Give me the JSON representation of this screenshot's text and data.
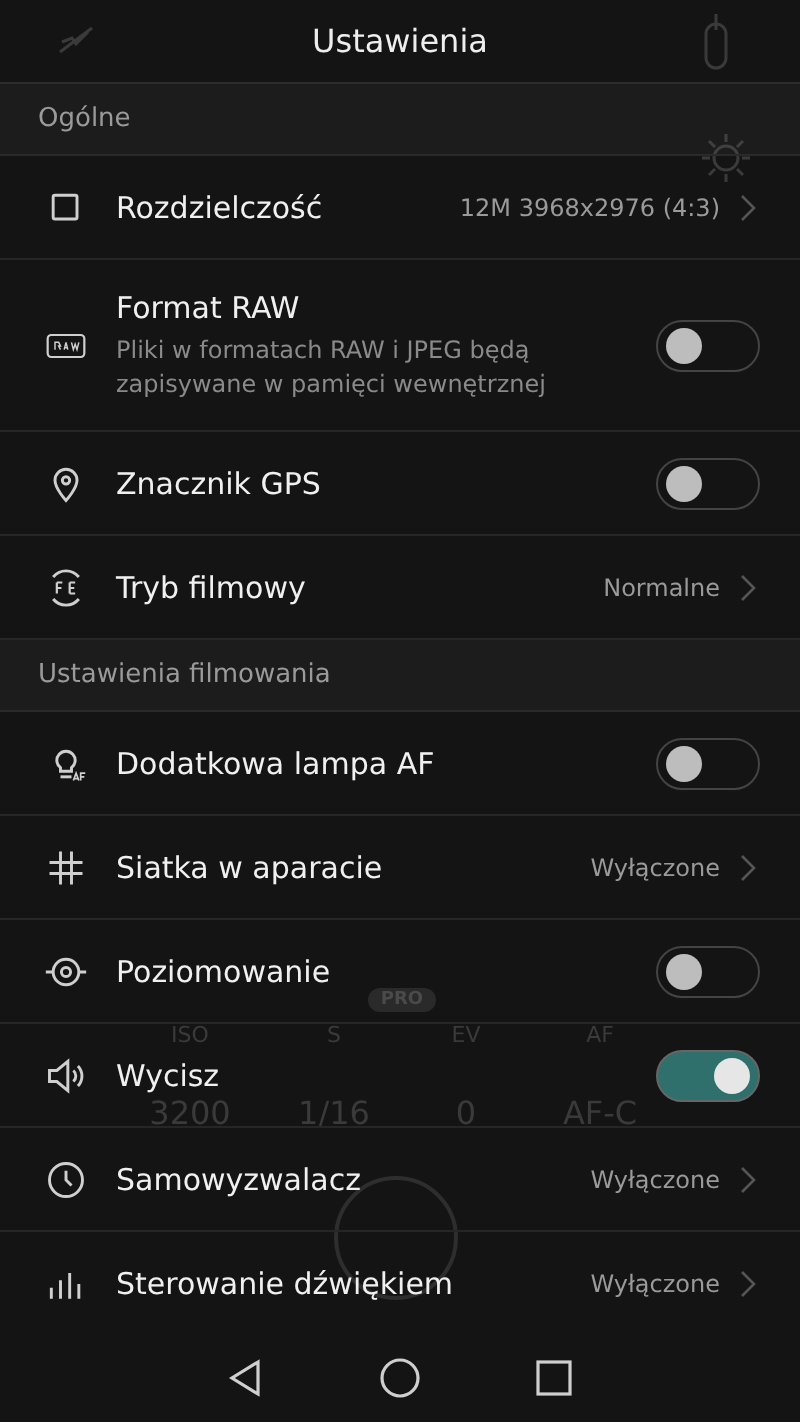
{
  "header": {
    "title": "Ustawienia"
  },
  "camera_background": {
    "mode_badge": "PRO",
    "parameters": [
      {
        "label": "ISO",
        "value": "3200"
      },
      {
        "label": "S",
        "value": "1/16"
      },
      {
        "label": "EV",
        "value": "0"
      },
      {
        "label": "AF",
        "value": "AF-C"
      }
    ]
  },
  "sections": [
    {
      "title": "Ogólne",
      "items": [
        {
          "kind": "value",
          "label": "Rozdzielczość",
          "value": "12M 3968x2976 (4:3)"
        },
        {
          "kind": "toggle",
          "label": "Format RAW",
          "description": "Pliki w formatach RAW i JPEG będą zapisywane w pamięci wewnętrznej",
          "on": false
        },
        {
          "kind": "toggle",
          "label": "Znacznik GPS",
          "on": false
        },
        {
          "kind": "value",
          "label": "Tryb filmowy",
          "value": "Normalne"
        }
      ]
    },
    {
      "title": "Ustawienia filmowania",
      "items": [
        {
          "kind": "toggle",
          "label": "Dodatkowa lampa AF",
          "on": false
        },
        {
          "kind": "value",
          "label": "Siatka w aparacie",
          "value": "Wyłączone"
        },
        {
          "kind": "toggle",
          "label": "Poziomowanie",
          "on": false
        },
        {
          "kind": "toggle",
          "label": "Wycisz",
          "on": true
        },
        {
          "kind": "value",
          "label": "Samowyzwalacz",
          "value": "Wyłączone"
        },
        {
          "kind": "value",
          "label": "Sterowanie dźwiękiem",
          "value": "Wyłączone"
        }
      ]
    }
  ]
}
